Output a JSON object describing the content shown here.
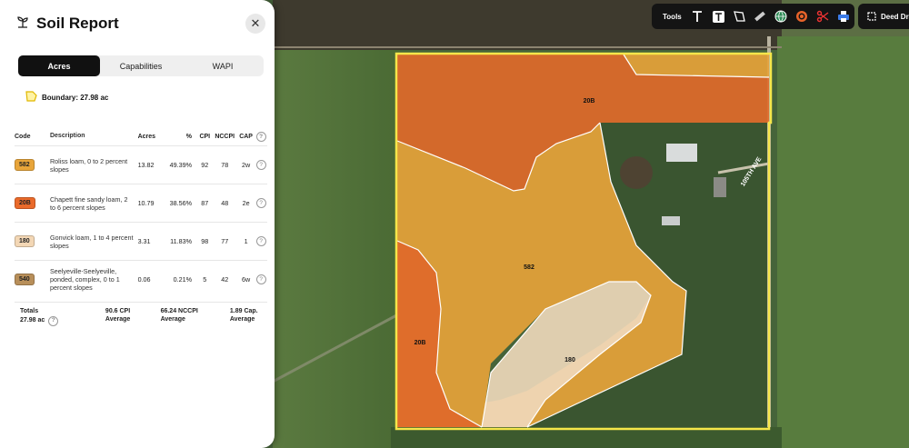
{
  "panel": {
    "title": "Soil Report",
    "close_glyph": "✕",
    "tabs": [
      {
        "label": "Acres",
        "active": true
      },
      {
        "label": "Capabilities",
        "active": false
      },
      {
        "label": "WAPI",
        "active": false
      }
    ],
    "boundary_label": "Boundary: 27.98 ac"
  },
  "table": {
    "headers": {
      "code": "Code",
      "description": "Description",
      "acres": "Acres",
      "percent": "%",
      "cpi": "CPI",
      "nccpi": "NCCPI",
      "cap": "CAP"
    },
    "rows": [
      {
        "code": "582",
        "color": "#e8a53a",
        "description": "Roliss loam, 0 to 2 percent slopes",
        "acres": "13.82",
        "percent": "49.39%",
        "cpi": "92",
        "nccpi": "78",
        "cap": "2w"
      },
      {
        "code": "20B",
        "color": "#ea6a2a",
        "description": "Chapett fine sandy loam, 2 to 6 percent slopes",
        "acres": "10.79",
        "percent": "38.56%",
        "cpi": "87",
        "nccpi": "48",
        "cap": "2e"
      },
      {
        "code": "180",
        "color": "#f3d7b5",
        "description": "Gonvick loam, 1 to 4 percent slopes",
        "acres": "3.31",
        "percent": "11.83%",
        "cpi": "98",
        "nccpi": "77",
        "cap": "1"
      },
      {
        "code": "540",
        "color": "#b88f5a",
        "description": "Seelyeville-Seelyeville, ponded, complex, 0 to 1 percent slopes",
        "acres": "0.06",
        "percent": "0.21%",
        "cpi": "5",
        "nccpi": "42",
        "cap": "6w"
      }
    ],
    "totals": {
      "label": "Totals",
      "acres": "27.98 ac",
      "cpi_value": "90.6 CPI",
      "cpi_sub": "Average",
      "nccpi_value": "66.24 NCCPI",
      "nccpi_sub": "Average",
      "cap_value": "1.89 Cap.",
      "cap_sub": "Average"
    }
  },
  "toolbar": {
    "label": "Tools",
    "deed_label": "Deed Dra"
  },
  "map": {
    "labels": {
      "zone_20b_top": "20B",
      "zone_582": "582",
      "zone_20b_left": "20B",
      "zone_180": "180"
    },
    "road_label": "105TH AVE",
    "boundary_color": "#f5e64a",
    "colors": {
      "z582": "#e6a23a",
      "z20b": "#e0692a",
      "z180": "#efd9bd"
    }
  },
  "icons": [
    "soil-plant-icon",
    "close-icon",
    "boundary-shape-icon",
    "help-icon",
    "text-icon",
    "text-box-icon",
    "polygon-icon",
    "ruler-icon",
    "globe-icon",
    "target-icon",
    "scissors-icon",
    "print-icon",
    "frame-icon"
  ]
}
